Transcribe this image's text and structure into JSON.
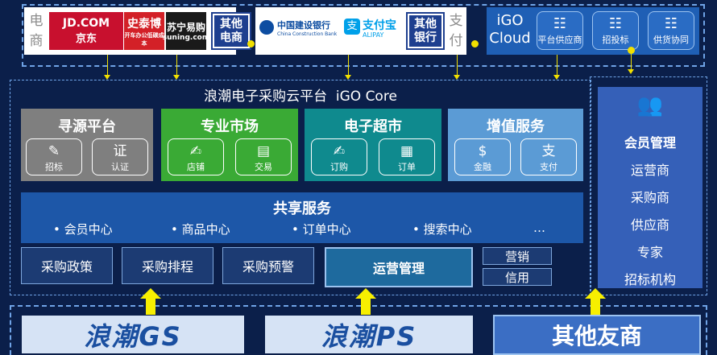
{
  "top_left": {
    "label_chars": [
      "电",
      "商"
    ],
    "logos": [
      {
        "line1": "JD.COM",
        "line2": "京东",
        "bg": "#c8102e",
        "fg": "#ffffff"
      },
      {
        "line1": "史泰博",
        "line2": "开车办公低碳成本",
        "bg": "#d32027",
        "fg": "#ffffff"
      },
      {
        "line1": "苏宁易购",
        "line2": "suning.com",
        "bg": "#1a1a1a",
        "fg": "#ffffff"
      }
    ],
    "other": "其他\n电商"
  },
  "top_mid": {
    "bank1": "中国建设银行",
    "bank1_en": "China Construction Bank",
    "alipay": "支付宝",
    "alipay_en": "ALIPAY",
    "other": "其他\n银行",
    "label_chars": [
      "支",
      "付"
    ]
  },
  "top_right": {
    "title_line1": "iGO",
    "title_line2": "Cloud",
    "buttons": [
      {
        "label": "平台供应商",
        "icon": "network-icon"
      },
      {
        "label": "招投标",
        "icon": "tender-icon"
      },
      {
        "label": "供货协同",
        "icon": "supply-icon"
      }
    ]
  },
  "core": {
    "title": "浪潮电子采购云平台  iGO Core",
    "categories": [
      {
        "title": "寻源平台",
        "bg": "#7f7f7f",
        "items": [
          {
            "label": "招标",
            "glyph": "✎"
          },
          {
            "label": "认证",
            "glyph": "证"
          }
        ]
      },
      {
        "title": "专业市场",
        "bg": "#3aaa35",
        "items": [
          {
            "label": "店铺",
            "glyph": "✍"
          },
          {
            "label": "交易",
            "glyph": "▤"
          }
        ]
      },
      {
        "title": "电子超市",
        "bg": "#0f8a8e",
        "items": [
          {
            "label": "订购",
            "glyph": "✍"
          },
          {
            "label": "订单",
            "glyph": "▦"
          }
        ]
      },
      {
        "title": "增值服务",
        "bg": "#5b9bd5",
        "items": [
          {
            "label": "金融",
            "glyph": "$"
          },
          {
            "label": "支付",
            "glyph": "支"
          }
        ]
      }
    ],
    "shared": {
      "title": "共享服务",
      "items": [
        "• 会员中心",
        "• 商品中心",
        "• 订单中心",
        "• 搜索中心",
        "…"
      ]
    },
    "bottom_services": [
      "采购政策",
      "采购排程",
      "采购预警"
    ],
    "ops": "运营管理",
    "small": [
      "营销",
      "信用"
    ]
  },
  "side": {
    "title": "会员管理",
    "items": [
      "运营商",
      "采购商",
      "供应商",
      "专家",
      "招标机构"
    ]
  },
  "bottom": {
    "brand1": "浪潮GS",
    "brand2": "浪潮PS",
    "other": "其他友商"
  }
}
